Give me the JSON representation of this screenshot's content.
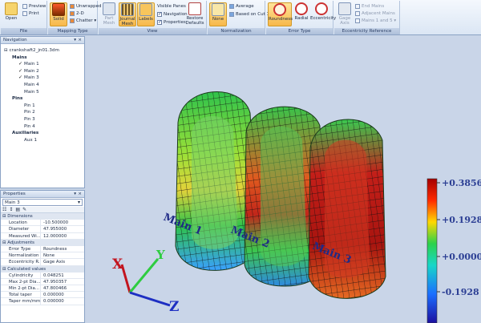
{
  "ribbon": {
    "file": {
      "label": "File",
      "open": "Open",
      "preview": "Preview",
      "print": "Print"
    },
    "mapping_type": {
      "label": "Mapping Type",
      "solid": "Solid",
      "unwrapped": "Unwrapped",
      "two_d": "2-D",
      "chatter": "Chatter"
    },
    "view": {
      "label": "View",
      "part_mesh": "Part Mesh",
      "journal_mesh": "Journal Mesh",
      "labels": "Labels",
      "visible_panes": "Visible Panes",
      "navigation": "Navigation",
      "properties": "Properties",
      "restore_defaults": "Restore Defaults"
    },
    "normalization": {
      "label": "Normalization",
      "none": "None",
      "average": "Average",
      "based_on_cut": "Based on Cut 1"
    },
    "error_type": {
      "label": "Error Type",
      "roundness": "Roundness",
      "radial": "Radial",
      "eccentricity": "Eccentricity"
    },
    "eccentricity_reference": {
      "label": "Eccentricity Reference",
      "gage_axis": "Gage Axis",
      "end_mains": "End Mains",
      "adjacent_mains": "Adjacent Mains",
      "mains_1_and_5": "Mains 1 and 5"
    }
  },
  "navigation": {
    "title": "Navigation",
    "file": "crankshaft2_jn01.3dm",
    "groups": [
      {
        "label": "Mains",
        "items": [
          {
            "label": "Main 1",
            "checked": true
          },
          {
            "label": "Main 2",
            "checked": true
          },
          {
            "label": "Main 3",
            "checked": true
          },
          {
            "label": "Main 4",
            "checked": false
          },
          {
            "label": "Main 5",
            "checked": false
          }
        ]
      },
      {
        "label": "Pins",
        "items": [
          {
            "label": "Pin 1",
            "checked": false
          },
          {
            "label": "Pin 2",
            "checked": false
          },
          {
            "label": "Pin 3",
            "checked": false
          },
          {
            "label": "Pin 4",
            "checked": false
          }
        ]
      },
      {
        "label": "Auxiliaries",
        "items": [
          {
            "label": "Aux 1",
            "checked": false
          }
        ]
      }
    ]
  },
  "properties": {
    "title": "Properties",
    "selected": "Main 3",
    "sections": [
      {
        "label": "Dimensions",
        "rows": [
          {
            "k": "Location",
            "v": "-10.500000"
          },
          {
            "k": "Diameter",
            "v": "47.955000"
          },
          {
            "k": "Measured Wi...",
            "v": "12.000000"
          }
        ]
      },
      {
        "label": "Adjustments",
        "rows": [
          {
            "k": "Error Type",
            "v": "Roundness"
          },
          {
            "k": "Normalization",
            "v": "None"
          },
          {
            "k": "Eccentricity R...",
            "v": "Gage Axis"
          }
        ]
      },
      {
        "label": "Calculated values",
        "rows": [
          {
            "k": "Cylindricity",
            "v": "0.048251"
          },
          {
            "k": "Max 2-pt Dia...",
            "v": "47.950357"
          },
          {
            "k": "Min 2-pt Dia...",
            "v": "47.800466"
          },
          {
            "k": "Total taper",
            "v": "0.000000"
          },
          {
            "k": "Taper mm/mm",
            "v": "0.000000"
          }
        ]
      }
    ]
  },
  "viewport": {
    "journal_labels": [
      "Main 1",
      "Main 2",
      "Main 3"
    ],
    "axes": {
      "x": "X",
      "y": "Y",
      "z": "Z"
    },
    "scale": {
      "ticks": [
        "+0.3856",
        "+0.1928",
        "+0.0000",
        "-0.1928"
      ],
      "low_color": "#2a2aa8",
      "mid_color": "#2bbf4a",
      "high_color": "#c81e1e"
    }
  }
}
